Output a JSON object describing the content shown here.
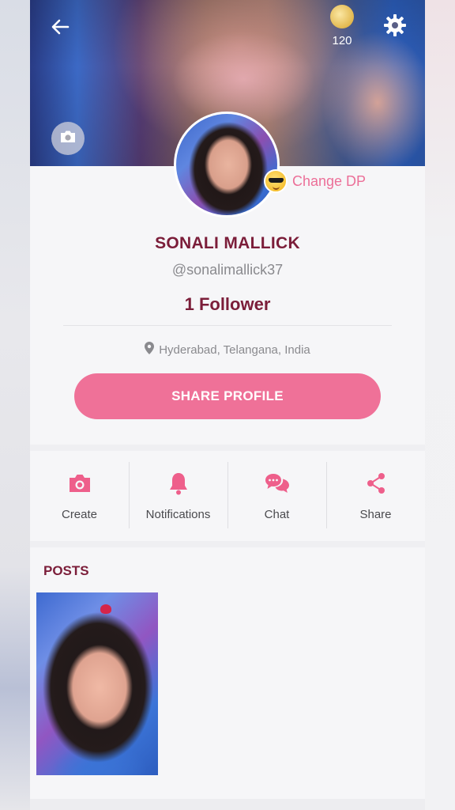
{
  "header": {
    "coin_count": "120"
  },
  "profile": {
    "change_dp_label": "Change DP",
    "name": "SONALI MALLICK",
    "handle": "@sonalimallick37",
    "followers": "1 Follower",
    "location": "Hyderabad, Telangana, India",
    "share_button": "SHARE PROFILE"
  },
  "actions": [
    {
      "label": "Create",
      "icon": "camera-icon"
    },
    {
      "label": "Notifications",
      "icon": "bell-icon"
    },
    {
      "label": "Chat",
      "icon": "chat-icon"
    },
    {
      "label": "Share",
      "icon": "share-icon"
    }
  ],
  "posts": {
    "title": "POSTS"
  },
  "colors": {
    "accent": "#ef7198",
    "title": "#7b1d39",
    "muted": "#8a8a8e"
  }
}
